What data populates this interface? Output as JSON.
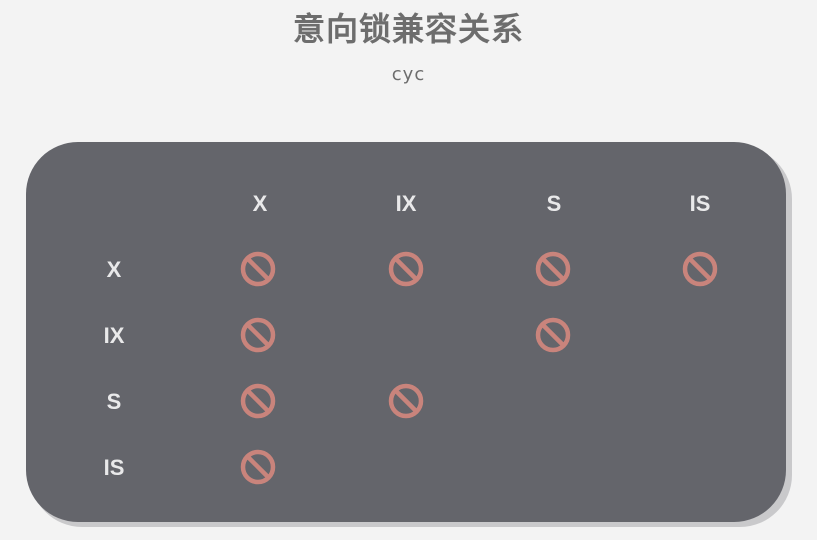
{
  "title": "意向锁兼容关系",
  "subtitle": "cyc",
  "matrix": {
    "columns": [
      "X",
      "IX",
      "S",
      "IS"
    ],
    "rows": [
      "X",
      "IX",
      "S",
      "IS"
    ],
    "conflicts": [
      [
        true,
        true,
        true,
        true
      ],
      [
        true,
        false,
        true,
        false
      ],
      [
        true,
        true,
        false,
        false
      ],
      [
        true,
        false,
        false,
        false
      ]
    ],
    "conflict_icon": "prohibited-icon",
    "conflict_color": "#c9847c",
    "background_color": "#64656b",
    "label_color": "#e9e9ea"
  }
}
